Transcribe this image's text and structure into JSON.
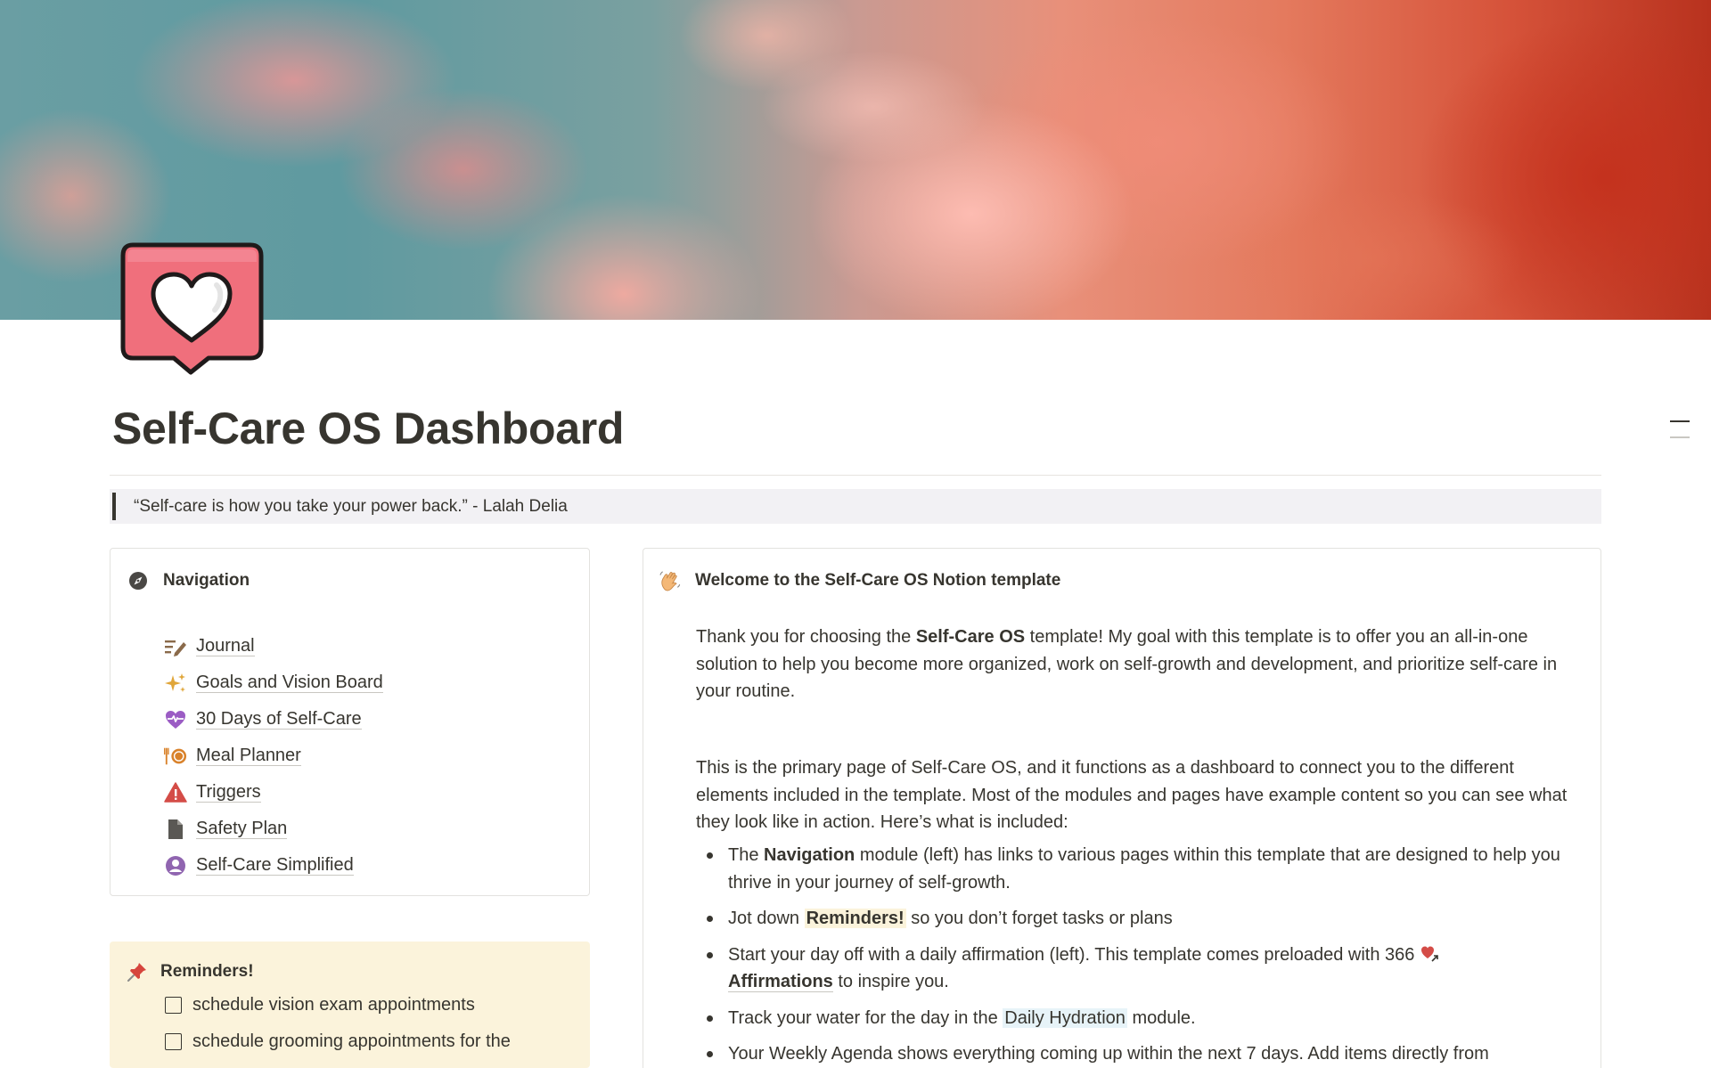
{
  "page": {
    "title": "Self-Care OS Dashboard",
    "quote": "“Self-care is how you take your power back.” - Lalah Delia"
  },
  "icons": {
    "page_icon": "heart-speech-bubble-icon",
    "toc": "table-of-contents-icon"
  },
  "navigation": {
    "heading": "Navigation",
    "heading_icon": "compass-icon",
    "items": [
      {
        "label": "Journal",
        "icon": "writing-icon"
      },
      {
        "label": "Goals and Vision Board",
        "icon": "sparkles-icon"
      },
      {
        "label": "30 Days of Self-Care",
        "icon": "heart-pulse-icon"
      },
      {
        "label": "Meal Planner",
        "icon": "fork-plate-icon"
      },
      {
        "label": "Triggers",
        "icon": "warning-icon"
      },
      {
        "label": "Safety Plan",
        "icon": "document-icon"
      },
      {
        "label": "Self-Care Simplified",
        "icon": "user-circle-icon"
      }
    ]
  },
  "reminders": {
    "heading": "Reminders!",
    "heading_icon": "pushpin-icon",
    "items": [
      {
        "label": "schedule vision exam appointments",
        "checked": false
      },
      {
        "label": "schedule grooming appointments for the",
        "checked": false
      }
    ]
  },
  "welcome": {
    "heading": "Welcome to the Self-Care OS Notion template",
    "heading_icon": "waving-hand-icon",
    "p1_a": "Thank you for choosing the ",
    "p1_bold": "Self-Care OS",
    "p1_b": " template! My goal with this template is to offer you an all-in-one solution to help you become more organized, work on self-growth and development, and prioritize self-care in your routine.",
    "p2": "This is the primary page of Self-Care OS, and it functions as a dashboard to connect you to the different elements included in the template. Most of the modules and pages have example content so you can see what they look like in action. Here’s what is included:",
    "b1_a": "The ",
    "b1_bold": "Navigation",
    "b1_b": " module (left) has links to various pages within this template that are designed to help you thrive in your journey of self-growth.",
    "b2_a": "Jot down ",
    "b2_hl": "Reminders!",
    "b2_b": " so you don’t forget tasks or plans",
    "b3_a": "Start your day off with a daily affirmation (left). This template comes preloaded with 366 ",
    "b3_link": "Affirmations",
    "b3_b": " to inspire you.",
    "b4_a": "Track your water for the day in the ",
    "b4_hl": "Daily Hydration",
    "b4_b": " module.",
    "b5": "Your Weekly Agenda shows everything coming up within the next 7 days. Add items directly from"
  },
  "colors": {
    "text": "#37352f",
    "reminder_bg": "#fbf3db",
    "quote_bg": "#f2f1f4",
    "icon_pink": "#f07a86"
  }
}
